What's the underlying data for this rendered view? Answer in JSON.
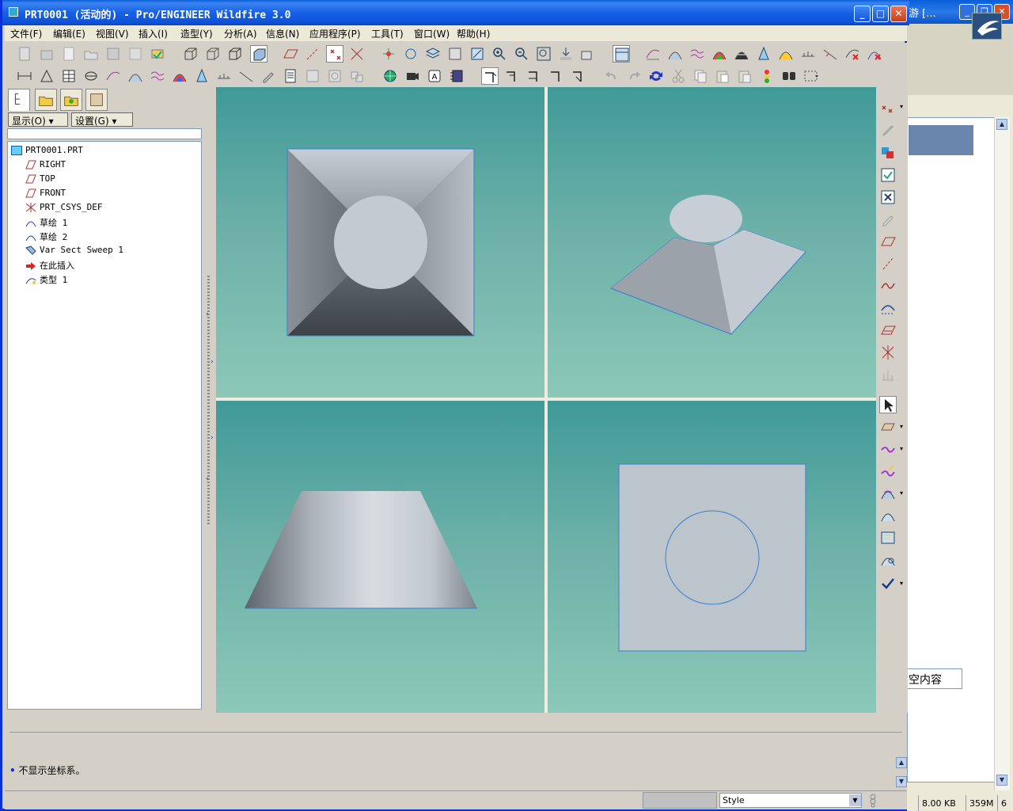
{
  "window": {
    "title": "PRT0001 (活动的) - Pro/ENGINEER Wildfire 3.0"
  },
  "menu": {
    "items": [
      "文件(F)",
      "编辑(E)",
      "视图(V)",
      "插入(I)",
      "造型(Y)",
      "分析(A)",
      "信息(N)",
      "应用程序(P)",
      "工具(T)",
      "窗口(W)",
      "帮助(H)"
    ]
  },
  "panel": {
    "show_label": "显示(O)",
    "settings_label": "设置(G)"
  },
  "tree": {
    "items": [
      "PRT0001.PRT",
      "RIGHT",
      "TOP",
      "FRONT",
      "PRT_CSYS_DEF",
      "草绘 1",
      "草绘 2",
      "Var Sect Sweep 1",
      "在此插入",
      "类型 1"
    ]
  },
  "message": {
    "text": "不显示坐标系。"
  },
  "status": {
    "style_select": "Style"
  },
  "background_window": {
    "title": "游 [...",
    "text_field": "空内容",
    "status_size": "8.00 KB",
    "status_mem": "359M",
    "status_num": "6"
  }
}
